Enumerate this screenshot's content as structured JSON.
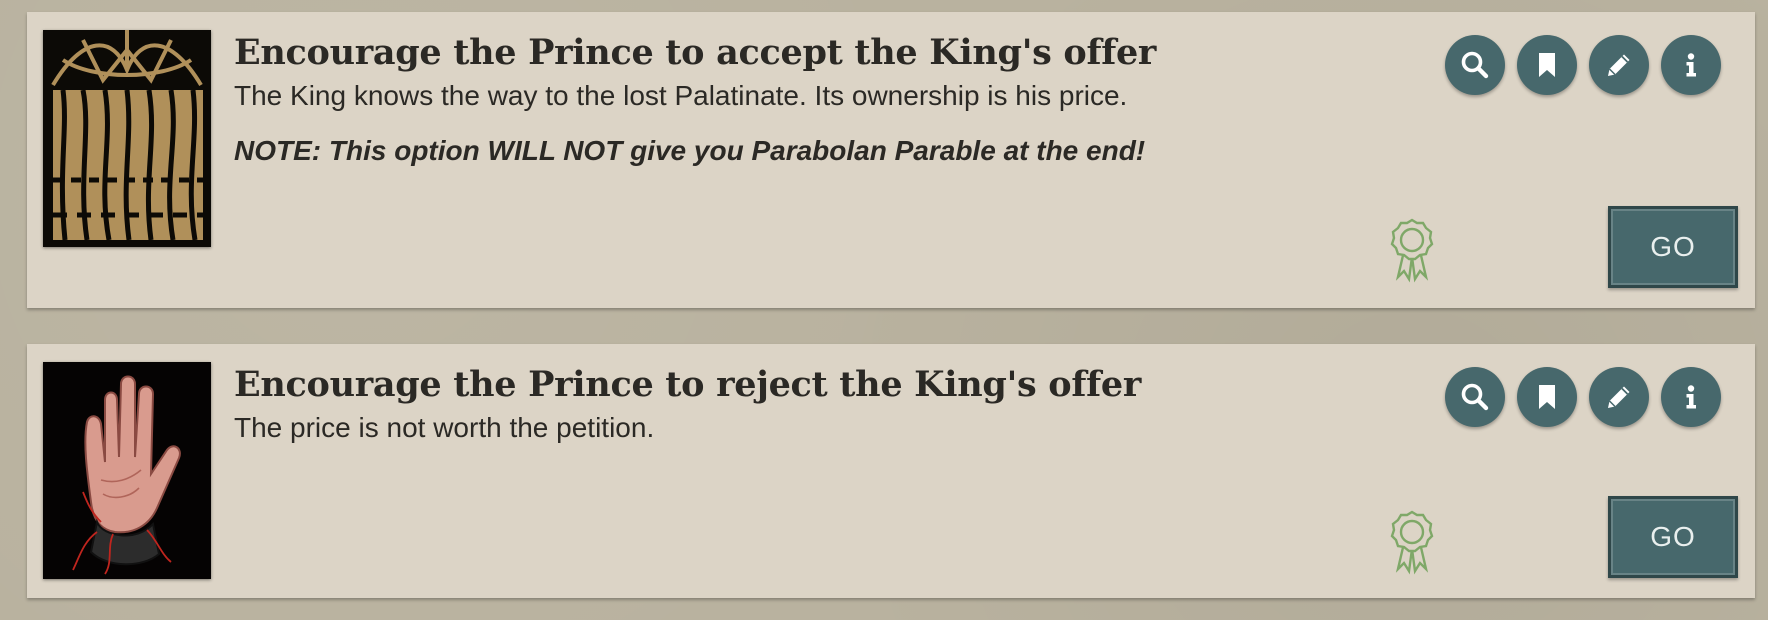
{
  "branches": [
    {
      "title": "Encourage the Prince to accept the King's offer",
      "description": "The King knows the way to the lost Palatinate. Its ownership is his price.",
      "note": "NOTE: This option WILL NOT give you Parabolan Parable at the end!",
      "image": "crown-of-thorns-icon",
      "go_label": "GO",
      "tools": [
        "search-icon",
        "bookmark-icon",
        "pencil-icon",
        "info-icon"
      ],
      "quality_icon": "rosette-icon"
    },
    {
      "title": "Encourage the Prince to reject the King's offer",
      "description": "The price is not worth the petition.",
      "image": "raised-hand-icon",
      "go_label": "GO",
      "tools": [
        "search-icon",
        "bookmark-icon",
        "pencil-icon",
        "info-icon"
      ],
      "quality_icon": "rosette-icon"
    }
  ],
  "colors": {
    "panel": "#dcd4c6",
    "background": "#b9b29f",
    "button": "#47686c",
    "text": "#2b2925",
    "quality": "#7fa868"
  }
}
